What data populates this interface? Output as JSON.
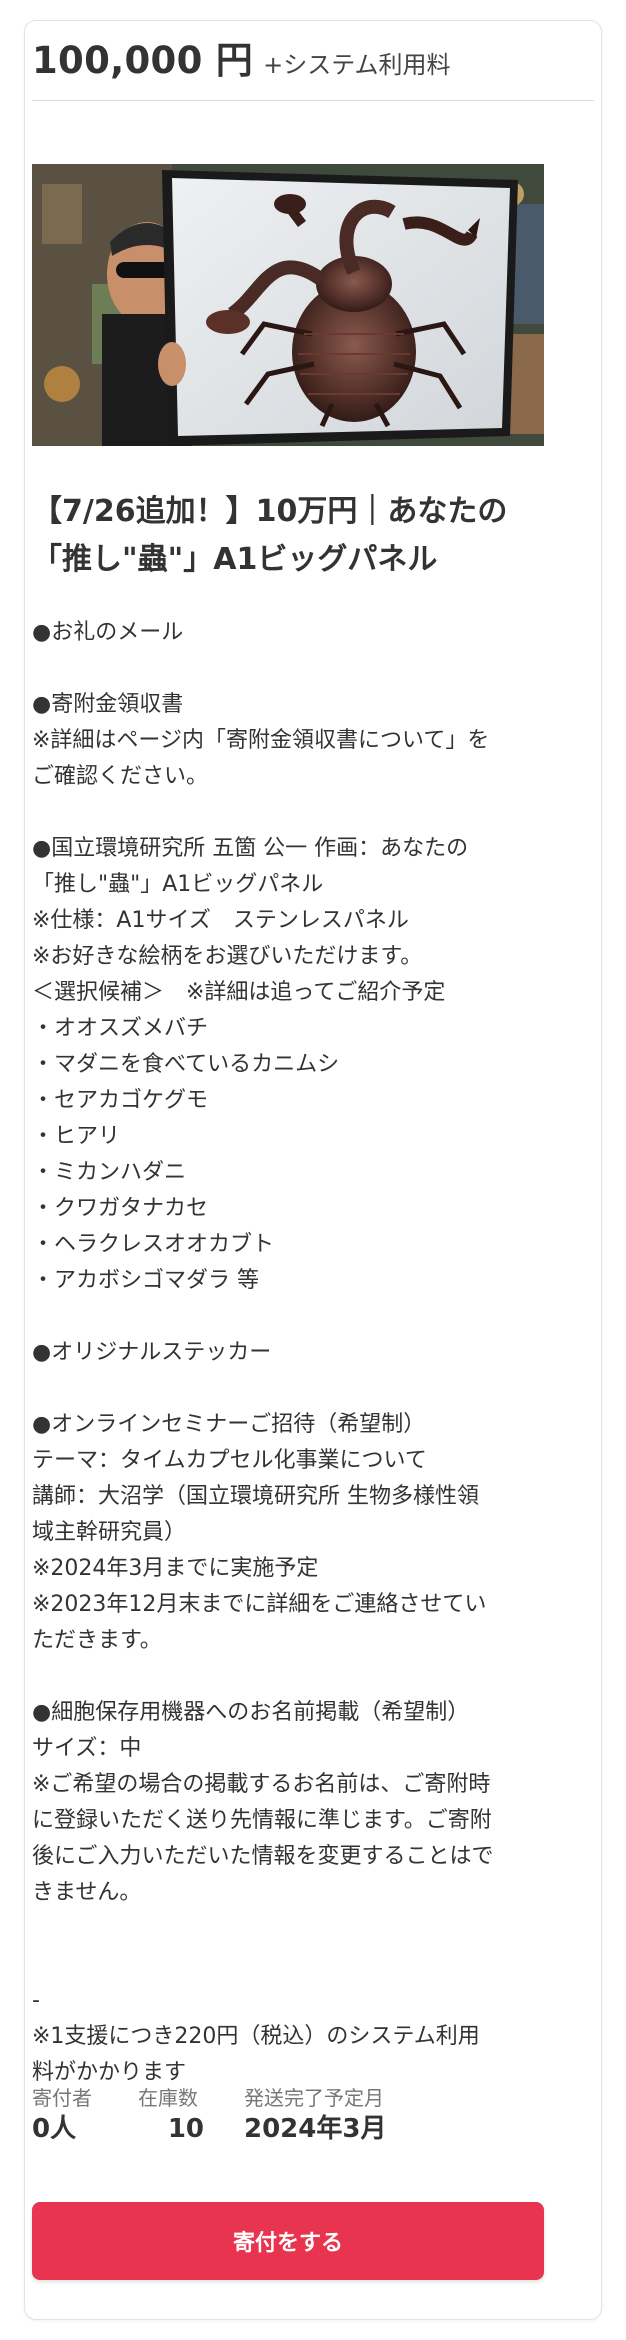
{
  "price": {
    "amount": "100,000 円",
    "fee_note": "+システム利用料"
  },
  "image": {
    "alt": "「推し\"蟲\"」A1ビッグパネル"
  },
  "product": {
    "title_lines": [
      "【7/26追加！】10万円｜あなたの",
      "「推し\"蟲\"」A1ビッグパネル"
    ],
    "description_lines": [
      "●お礼のメール",
      "",
      "●寄附金領収書",
      "※詳細はページ内「寄附金領収書について」を",
      "ご確認ください。",
      "",
      "●国立環境研究所 五箇 公一 作画：あなたの",
      "「推し\"蟲\"」A1ビッグパネル",
      "※仕様：A1サイズ　ステンレスパネル",
      "※お好きな絵柄をお選びいただけます。",
      "＜選択候補＞　※詳細は追ってご紹介予定",
      "・オオスズメバチ",
      "・マダニを食べているカニムシ",
      "・セアカゴケグモ",
      "・ヒアリ",
      "・ミカンハダニ",
      "・クワガタナカセ",
      "・ヘラクレスオオカブト",
      "・アカボシゴマダラ 等",
      "",
      "●オリジナルステッカー",
      "",
      "●オンラインセミナーご招待（希望制）",
      "テーマ：タイムカプセル化事業について",
      "講師：大沼学（国立環境研究所 生物多様性領",
      "域主幹研究員）",
      "※2024年3月までに実施予定",
      "※2023年12月末までに詳細をご連絡させてい",
      "ただきます。",
      "",
      "●細胞保存用機器へのお名前掲載（希望制）",
      "サイズ：中",
      "※ご希望の場合の掲載するお名前は、ご寄附時",
      "に登録いただく送り先情報に準じます。ご寄附",
      "後にご入力いただいた情報を変更することはで",
      "きません。",
      "",
      "",
      "-",
      "※1支援につき220円（税込）のシステム利用",
      "料がかかります"
    ]
  },
  "stats": {
    "donors": {
      "label": "寄付者",
      "value": "0人"
    },
    "stock": {
      "label": "在庫数",
      "value": "10"
    },
    "shipping": {
      "label": "発送完了予定月",
      "value": "2024年3月"
    }
  },
  "cta": {
    "label": "寄付をする",
    "color": "#e8344e"
  }
}
